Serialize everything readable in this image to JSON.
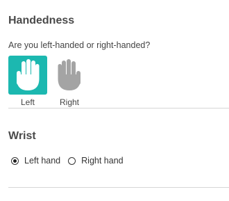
{
  "handedness": {
    "title": "Handedness",
    "question": "Are you left-handed or right-handed?",
    "options": [
      {
        "label": "Left",
        "selected": true,
        "icon": "hand-icon",
        "tile_color": "#1cb8b0",
        "icon_color": "#ffffff"
      },
      {
        "label": "Right",
        "selected": false,
        "icon": "hand-icon",
        "tile_color": "#ffffff",
        "icon_color": "#a4a4a4"
      }
    ]
  },
  "wrist": {
    "title": "Wrist",
    "options": [
      {
        "label": "Left hand",
        "selected": true
      },
      {
        "label": "Right hand",
        "selected": false
      }
    ]
  }
}
